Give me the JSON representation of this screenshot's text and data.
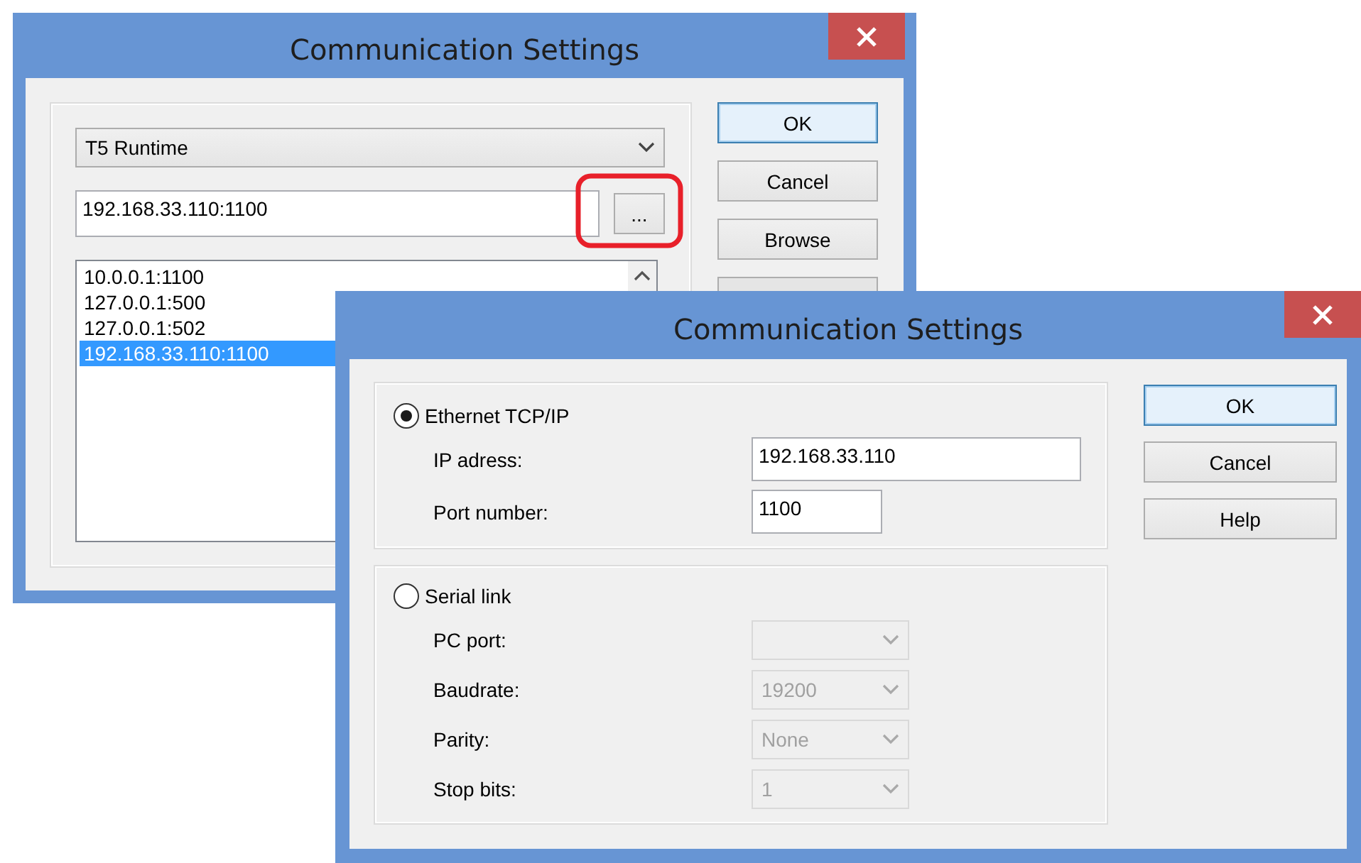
{
  "back_window": {
    "title": "Communication Settings",
    "runtime_dropdown": {
      "value": "T5 Runtime"
    },
    "address_field": {
      "value": "192.168.33.110:1100"
    },
    "ellipsis_button": {
      "label": "..."
    },
    "addresses": [
      {
        "label": "10.0.0.1:1100",
        "selected": false
      },
      {
        "label": "127.0.0.1:500",
        "selected": false
      },
      {
        "label": "127.0.0.1:502",
        "selected": false
      },
      {
        "label": "192.168.33.110:1100",
        "selected": true
      }
    ],
    "buttons": [
      {
        "label": "OK",
        "default": true
      },
      {
        "label": "Cancel",
        "default": false
      },
      {
        "label": "Browse",
        "default": false
      }
    ]
  },
  "front_window": {
    "title": "Communication Settings",
    "connections": [
      {
        "label": "Ethernet TCP/IP",
        "selected": true,
        "fields": [
          {
            "kind": "text",
            "label": "IP adress:",
            "value": "192.168.33.110",
            "disabled": false,
            "wide": true
          },
          {
            "kind": "text",
            "label": "Port number:",
            "value": "1100",
            "disabled": false,
            "wide": false
          }
        ]
      },
      {
        "label": "Serial link",
        "selected": false,
        "fields": [
          {
            "kind": "combo",
            "label": "PC port:",
            "disabled": true
          },
          {
            "kind": "combo",
            "label": "Baudrate:",
            "value": "19200",
            "disabled": true
          },
          {
            "kind": "combo",
            "label": "Parity:",
            "value": "None",
            "disabled": true
          },
          {
            "kind": "combo",
            "label": "Stop bits:",
            "value": "1",
            "disabled": true
          }
        ]
      }
    ],
    "buttons": [
      {
        "label": "OK",
        "default": true
      },
      {
        "label": "Cancel",
        "default": false
      },
      {
        "label": "Help",
        "default": false
      }
    ]
  }
}
